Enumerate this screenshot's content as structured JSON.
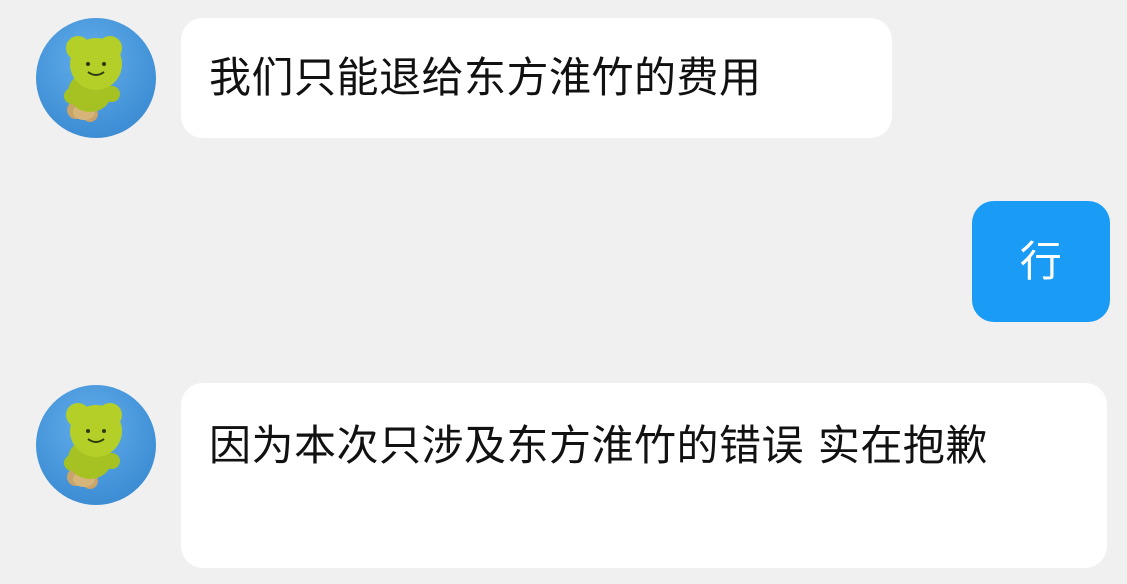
{
  "messages": [
    {
      "sender": "contact",
      "text": "我们只能退给东方淮竹的费用"
    },
    {
      "sender": "self",
      "text": "行"
    },
    {
      "sender": "contact",
      "text": "因为本次只涉及东方淮竹的错误 实在抱歉"
    }
  ],
  "colors": {
    "background": "#f0f0f0",
    "incoming_bubble": "#ffffff",
    "outgoing_bubble": "#1a9bf5",
    "avatar_bg": "#4a97dc",
    "avatar_figure": "#a6c222"
  },
  "icons": {
    "contact_avatar": "green-plush-frog-avatar"
  }
}
